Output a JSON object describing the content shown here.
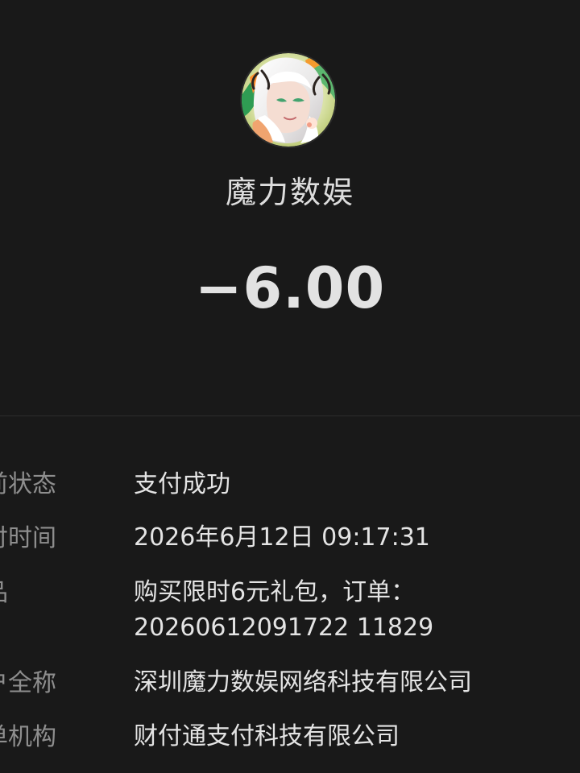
{
  "merchant": {
    "avatar_icon": "anime-avatar-icon",
    "name": "魔力数娱"
  },
  "transaction": {
    "amount": "−6.00"
  },
  "details": [
    {
      "label": "前状态",
      "value": "支付成功"
    },
    {
      "label": "付时间",
      "value": "2026年6月12日 09:17:31"
    },
    {
      "label": "品",
      "value_lines": [
        "购买限时6元礼包，订单：",
        "20260612091722 11829"
      ]
    },
    {
      "label": "户全称",
      "value": "深圳魔力数娱网络科技有限公司"
    },
    {
      "label": "单机构",
      "value": "财付通支付科技有限公司"
    }
  ],
  "colors": {
    "background": "#191919",
    "primary_text": "#e4e4e4",
    "secondary_text": "#8e8e8e",
    "divider": "#2c2c2c"
  }
}
